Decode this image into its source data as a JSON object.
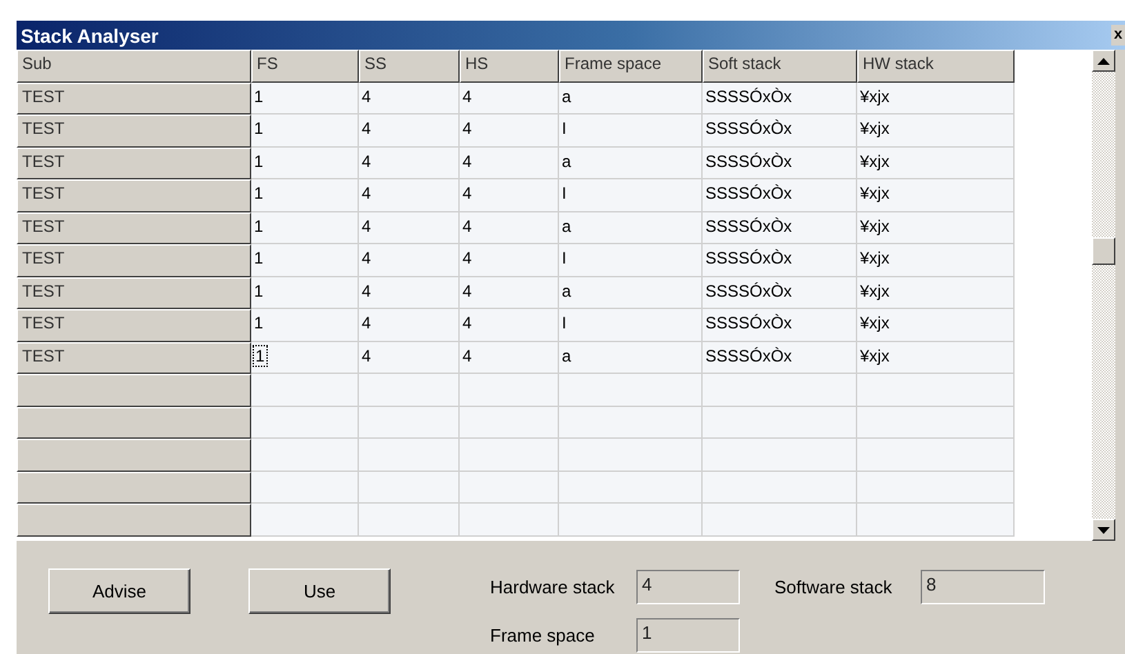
{
  "window": {
    "title": "Stack Analyser",
    "close": "x"
  },
  "table": {
    "columns": [
      "Sub",
      "FS",
      "SS",
      "HS",
      "Frame space",
      "Soft stack",
      "HW stack"
    ],
    "rows": [
      {
        "sub": "TEST",
        "fs": "1",
        "ss": "4",
        "hs": "4",
        "frame_space": "a",
        "soft_stack": "SSSSÓxÒx",
        "hw_stack": "¥xjx",
        "focused": false
      },
      {
        "sub": "TEST",
        "fs": "1",
        "ss": "4",
        "hs": "4",
        "frame_space": "I",
        "soft_stack": "SSSSÓxÒx",
        "hw_stack": "¥xjx",
        "focused": false
      },
      {
        "sub": "TEST",
        "fs": "1",
        "ss": "4",
        "hs": "4",
        "frame_space": "a",
        "soft_stack": "SSSSÓxÒx",
        "hw_stack": "¥xjx",
        "focused": false
      },
      {
        "sub": "TEST",
        "fs": "1",
        "ss": "4",
        "hs": "4",
        "frame_space": "I",
        "soft_stack": "SSSSÓxÒx",
        "hw_stack": "¥xjx",
        "focused": false
      },
      {
        "sub": "TEST",
        "fs": "1",
        "ss": "4",
        "hs": "4",
        "frame_space": "a",
        "soft_stack": "SSSSÓxÒx",
        "hw_stack": "¥xjx",
        "focused": false
      },
      {
        "sub": "TEST",
        "fs": "1",
        "ss": "4",
        "hs": "4",
        "frame_space": "I",
        "soft_stack": "SSSSÓxÒx",
        "hw_stack": "¥xjx",
        "focused": false
      },
      {
        "sub": "TEST",
        "fs": "1",
        "ss": "4",
        "hs": "4",
        "frame_space": "a",
        "soft_stack": "SSSSÓxÒx",
        "hw_stack": "¥xjx",
        "focused": false
      },
      {
        "sub": "TEST",
        "fs": "1",
        "ss": "4",
        "hs": "4",
        "frame_space": "I",
        "soft_stack": "SSSSÓxÒx",
        "hw_stack": "¥xjx",
        "focused": false
      },
      {
        "sub": "TEST",
        "fs": "1",
        "ss": "4",
        "hs": "4",
        "frame_space": "a",
        "soft_stack": "SSSSÓxÒx",
        "hw_stack": "¥xjx",
        "focused": true
      }
    ]
  },
  "buttons": [
    "Advise",
    "Use"
  ],
  "fields": [
    {
      "label": "Hardware stack",
      "value": "4"
    },
    {
      "label": "Software stack",
      "value": "8"
    },
    {
      "label": "Frame space",
      "value": "1"
    }
  ]
}
